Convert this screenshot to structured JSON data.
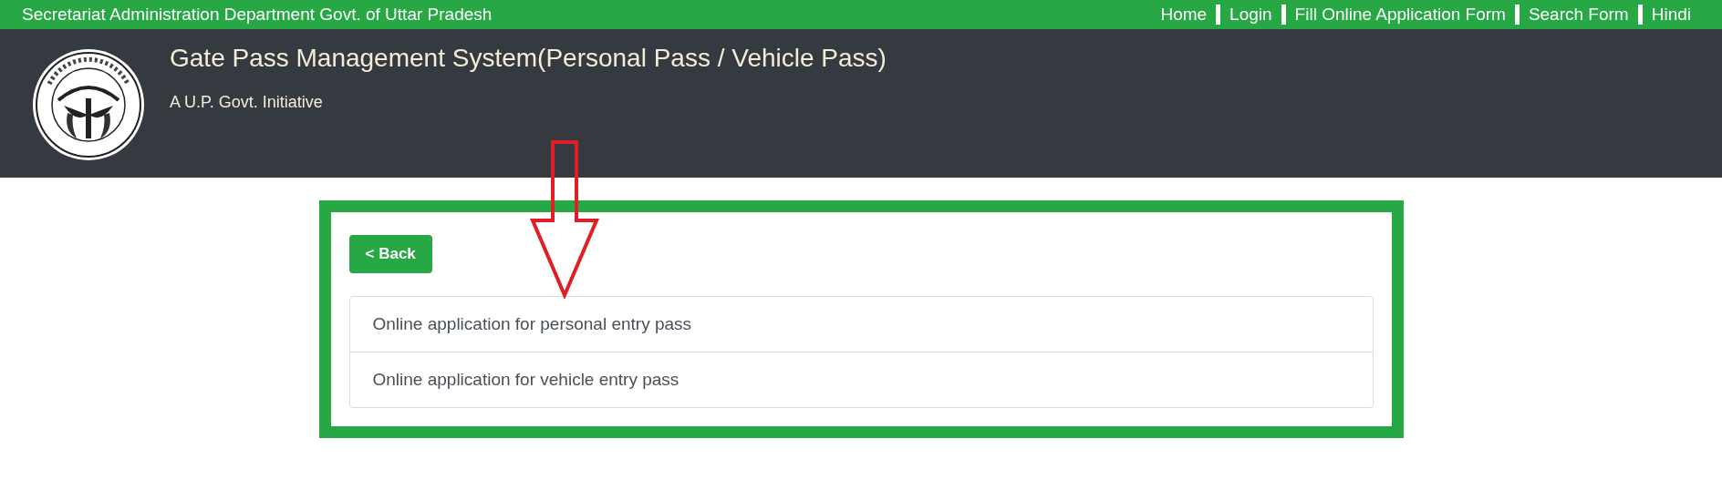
{
  "top_bar": {
    "department": "Secretariat Administration Department Govt. of Uttar Pradesh",
    "nav": [
      "Home",
      "Login",
      "Fill Online Application Form",
      "Search Form",
      "Hindi"
    ]
  },
  "header": {
    "title": "Gate Pass Management System(Personal Pass / Vehicle Pass)",
    "subtitle": "A U.P. Govt. Initiative"
  },
  "back_button": "< Back",
  "options": [
    "Online application for personal entry pass",
    "Online application for vehicle entry pass"
  ]
}
